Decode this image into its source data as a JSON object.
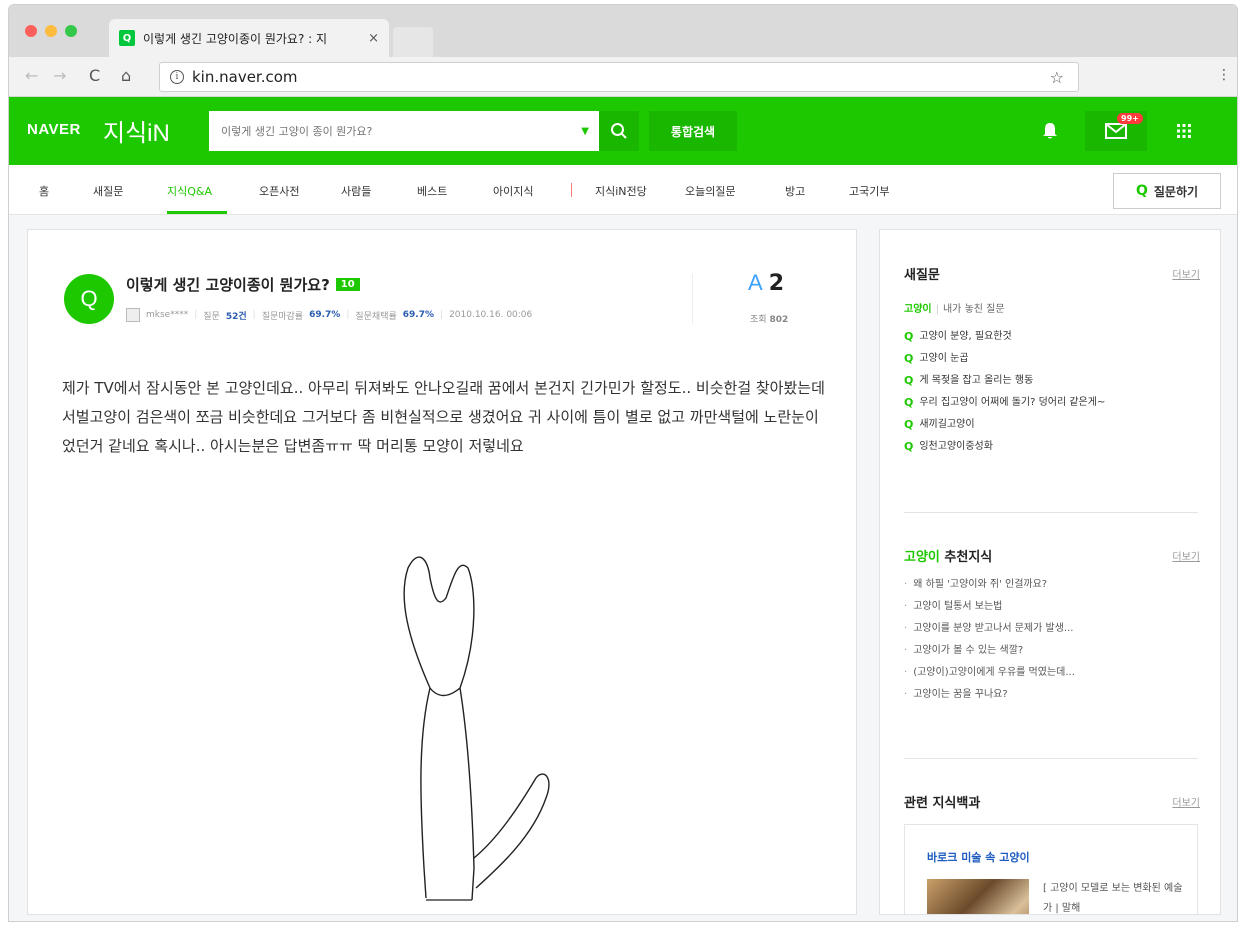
{
  "browser": {
    "tab_title": "이렇게 생긴 고양이종이 뭔가요? : 지",
    "tab_close": "×",
    "url": "kin.naver.com"
  },
  "header": {
    "logo_naver": "NAVER",
    "logo_kin": "지식iN",
    "search_placeholder": "이렇게 생긴 고양이 종이 뭔가요?",
    "total_search_label": "통합검색",
    "mail_badge": "99+"
  },
  "subnav": {
    "items": [
      "홈",
      "새질문",
      "지식Q&A",
      "오픈사전",
      "사람들",
      "베스트",
      "아이지식",
      "지식iN전당",
      "오늘의질문",
      "방고",
      "고국기부"
    ],
    "active": "지식Q&A",
    "ask_label": "질문하기"
  },
  "question": {
    "icon_letter": "Q",
    "title": "이렇게 생긴 고양이종이 뭔가요?",
    "level": "10",
    "author": "mkse****",
    "question_label": "질문",
    "question_count": "52건",
    "close_rate_label": "질문마감률",
    "close_rate": "69.7%",
    "adopt_rate_label": "질문채택률",
    "adopt_rate": "69.7%",
    "date": "2010.10.16. 00:06",
    "answer_letter": "A",
    "answer_count": "2",
    "views_label": "조회",
    "views": "802",
    "body": "제가 TV에서 잠시동안 본 고양인데요.. 아무리 뒤져봐도 안나오길래 꿈에서 본건지 긴가민가 할정도.. 비슷한걸 찾아봤는데 서벌고양이 검은색이 쪼금 비슷한데요 그거보다 좀 비현실적으로 생겼어요 귀 사이에 틈이 별로 없고 까만색털에 노란눈이었던거 같네요 혹시나.. 아시는분은 답변좀ㅠㅠ 딱 머리통 모양이 저렇네요"
  },
  "sidebar": {
    "new_q_title": "새질문",
    "more": "더보기",
    "tab_on": "고양이",
    "tab_off": "내가 놓친 질문",
    "new_questions": [
      "고양이 분양, 필요한것",
      "고양이 눈곱",
      "게 목젖을 잡고 올리는 행동",
      "우리 집고양이 어쩌에 돌기? 덩어리 같은게~",
      "새끼길고양이",
      "잉천고양이중성화"
    ],
    "rec_keyword": "고양이",
    "rec_title": "추천지식",
    "recommended": [
      "왜 하필 '고양이와 쥐' 인걸까요?",
      "고양이 털통서 보는법",
      "고양이를 분양 받고나서 문제가 발생...",
      "고양이가 볼 수 있는 색깔?",
      "(고양이)고양이에게 우유를 먹였는데...",
      "고양이는 꿈을 꾸나요?"
    ],
    "encyc_title": "관련 지식백과",
    "encyc_item_title": "바로크 미술 속 고양이",
    "encyc_item_desc": "[ 고양이 모델로 보는 변화된 예술가 | 말해"
  }
}
